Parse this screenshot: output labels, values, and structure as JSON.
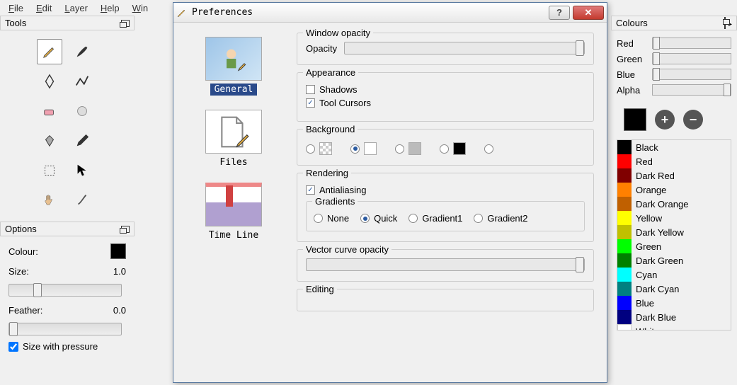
{
  "menu": {
    "file": "File",
    "edit": "Edit",
    "layer": "Layer",
    "help": "Help",
    "win": "Win"
  },
  "tools_panel": {
    "title": "Tools"
  },
  "options_panel": {
    "title": "Options",
    "colour_label": "Colour:",
    "size_label": "Size:",
    "size_value": "1.0",
    "feather_label": "Feather:",
    "feather_value": "0.0",
    "size_pressure": "Size with pressure"
  },
  "dialog": {
    "title": "Preferences",
    "nav": {
      "general": "General",
      "files": "Files",
      "timeline": "Time Line"
    },
    "window_opacity": {
      "group": "Window opacity",
      "label": "Opacity"
    },
    "appearance": {
      "group": "Appearance",
      "shadows": "Shadows",
      "tool_cursors": "Tool Cursors"
    },
    "background": {
      "group": "Background"
    },
    "rendering": {
      "group": "Rendering",
      "antialiasing": "Antialiasing",
      "gradients_group": "Gradients",
      "none": "None",
      "quick": "Quick",
      "g1": "Gradient1",
      "g2": "Gradient2"
    },
    "vector": {
      "group": "Vector curve opacity"
    },
    "editing": {
      "group": "Editing"
    }
  },
  "colours_panel": {
    "title": "Colours",
    "red": "Red",
    "green": "Green",
    "blue": "Blue",
    "alpha": "Alpha",
    "list": [
      {
        "name": "Black",
        "hex": "#000000"
      },
      {
        "name": "Red",
        "hex": "#ff0000"
      },
      {
        "name": "Dark Red",
        "hex": "#800000"
      },
      {
        "name": "Orange",
        "hex": "#ff8000"
      },
      {
        "name": "Dark Orange",
        "hex": "#c06000"
      },
      {
        "name": "Yellow",
        "hex": "#ffff00"
      },
      {
        "name": "Dark Yellow",
        "hex": "#c0c000"
      },
      {
        "name": "Green",
        "hex": "#00ff00"
      },
      {
        "name": "Dark Green",
        "hex": "#008000"
      },
      {
        "name": "Cyan",
        "hex": "#00ffff"
      },
      {
        "name": "Dark Cyan",
        "hex": "#008080"
      },
      {
        "name": "Blue",
        "hex": "#0000ff"
      },
      {
        "name": "Dark Blue",
        "hex": "#000080"
      },
      {
        "name": "White",
        "hex": "#ffffff"
      }
    ]
  }
}
